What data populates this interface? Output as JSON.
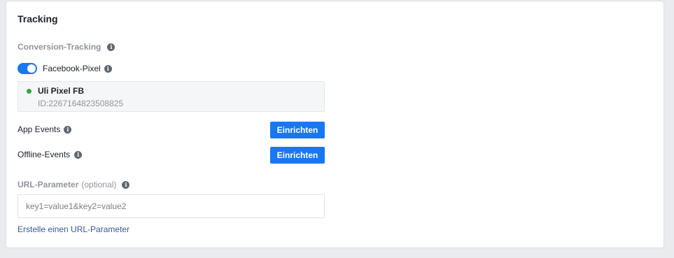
{
  "card": {
    "title": "Tracking"
  },
  "conversion_tracking": {
    "label": "Conversion-Tracking",
    "facebook_pixel": {
      "label": "Facebook-Pixel",
      "enabled": true,
      "pixel_name": "Uli Pixel FB",
      "pixel_id": "ID:2267164823508825",
      "status_color": "#2eaa3c"
    },
    "app_events": {
      "label": "App Events",
      "button_label": "Einrichten"
    },
    "offline_events": {
      "label": "Offline-Events",
      "button_label": "Einrichten"
    }
  },
  "url_parameter": {
    "label": "URL-Parameter",
    "optional_label": "(optional)",
    "placeholder": "key1=value1&key2=value2",
    "value": "",
    "link_text": "Erstelle einen URL-Parameter"
  },
  "icons": {
    "info": "i"
  },
  "colors": {
    "accent": "#1877f2",
    "link": "#385898"
  }
}
